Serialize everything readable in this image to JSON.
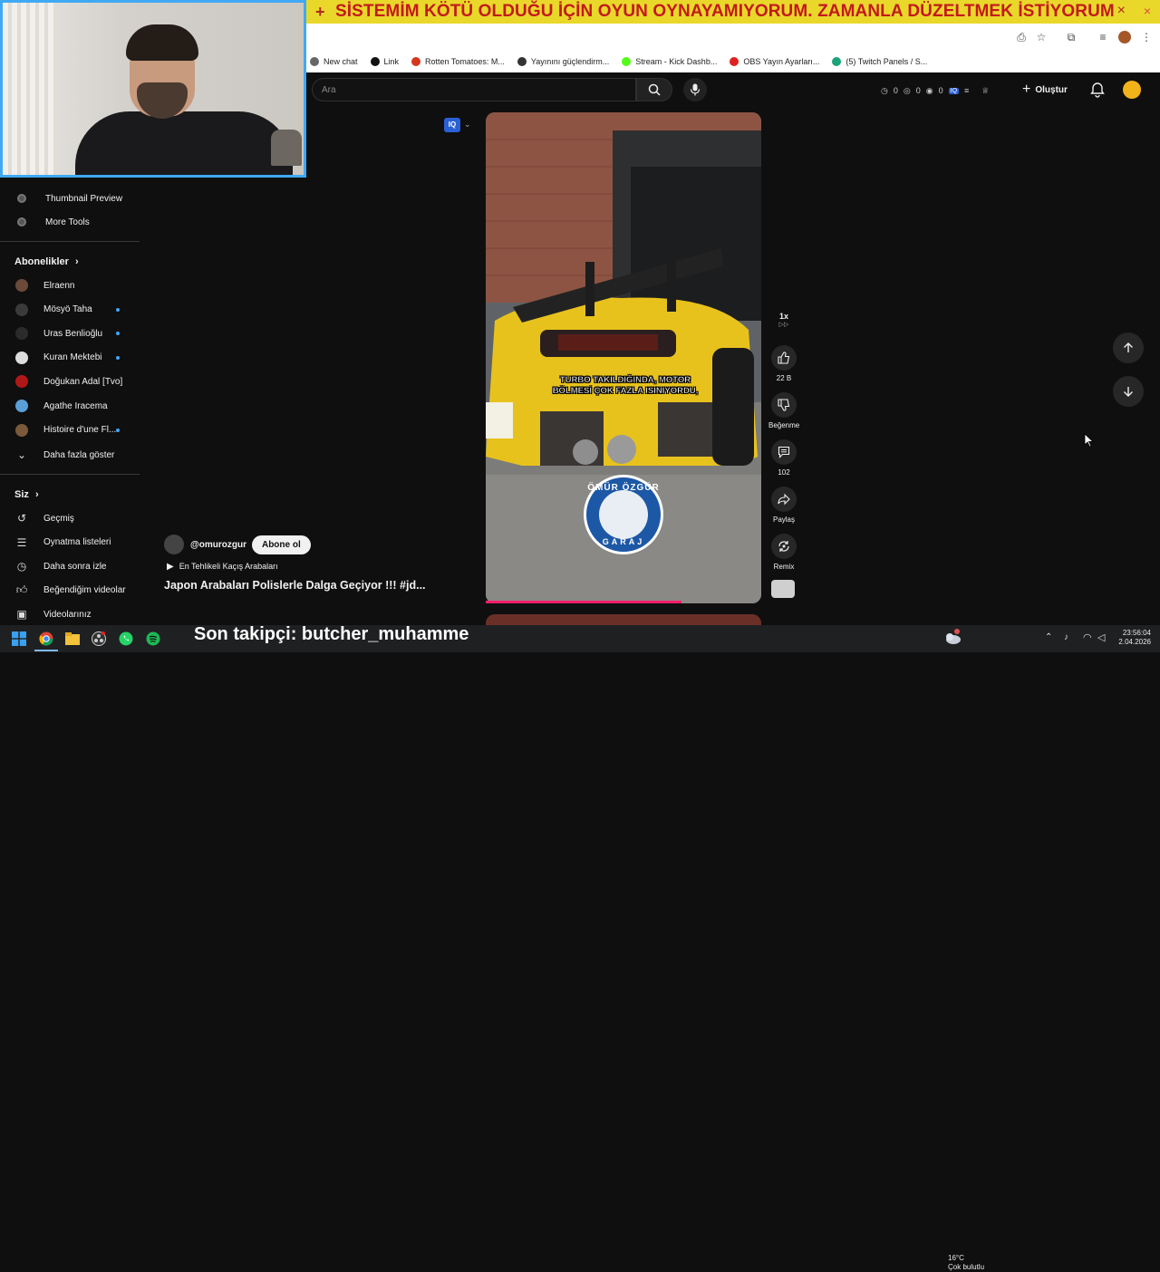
{
  "banner": {
    "text": "SİSTEMİM KÖTÜ OLDUĞU İÇİN OYUN OYNAYAMIYORUM. ZAMANLA DÜZELTMEK İSTİYORUM",
    "plus": "+",
    "close": "×"
  },
  "browser": {
    "close": "×"
  },
  "bookmarks": [
    {
      "label": "New chat",
      "color": "#666666"
    },
    {
      "label": "Link",
      "color": "#111111"
    },
    {
      "label": "Rotten Tomatoes: M...",
      "color": "#d6361b"
    },
    {
      "label": "Yayınını güçlendirm...",
      "color": "#333333"
    },
    {
      "label": "Stream - Kick Dashb...",
      "color": "#53fc18"
    },
    {
      "label": "OBS Yayın Ayarları...",
      "color": "#e02020"
    },
    {
      "label": "(5) Twitch Panels / S...",
      "color": "#1ba37a"
    }
  ],
  "sidebar": {
    "tools": [
      {
        "label": "Thumbnail Preview",
        "icon": "tool-icon"
      },
      {
        "label": "More Tools",
        "icon": "tool-icon"
      }
    ],
    "subscriptions_header": "Abonelikler",
    "subscriptions": [
      {
        "label": "Elraenn",
        "avatar_color": "#6b4a3a",
        "live": false
      },
      {
        "label": "Mösyö Taha",
        "avatar_color": "#3a3a3a",
        "live": true
      },
      {
        "label": "Uras Benlioğlu",
        "avatar_color": "#2b2b2b",
        "live": true
      },
      {
        "label": "Kuran Mektebi",
        "avatar_color": "#dddddd",
        "live": true
      },
      {
        "label": "Doğukan Adal [Tvo]",
        "avatar_color": "#b01818",
        "live": false
      },
      {
        "label": "Agathe Iracema",
        "avatar_color": "#5aa0d8",
        "live": false
      },
      {
        "label": "Histoire d'une Fl...",
        "avatar_color": "#7a5a3a",
        "live": true
      }
    ],
    "show_more": "Daha fazla göster",
    "you_header": "Siz",
    "you_items": [
      {
        "label": "Geçmiş",
        "icon": "history-icon"
      },
      {
        "label": "Oynatma listeleri",
        "icon": "playlist-icon"
      },
      {
        "label": "Daha sonra izle",
        "icon": "clock-icon"
      },
      {
        "label": "Beğendiğim videolar",
        "icon": "thumbs-up-icon"
      },
      {
        "label": "Videolarınız",
        "icon": "video-icon"
      }
    ]
  },
  "search": {
    "placeholder": "Ara"
  },
  "header": {
    "stats": [
      "0",
      "0",
      "0"
    ],
    "create_label": "Oluştur"
  },
  "short": {
    "caption": "TURBO TAKILDIĞINDA, MOTOR BÖLMESİ ÇOK FAZLA ISINIYORDU,",
    "logo_top": "ÖMÜR ÖZGÜR",
    "logo_bottom": "GARAJ",
    "progress": 0.71,
    "iq_badge": "IQ",
    "speed": "1x"
  },
  "actions": {
    "likes": "22 B",
    "dislike_label": "Beğenme",
    "comments": "102",
    "share_label": "Paylaş",
    "remix_label": "Remix"
  },
  "channel": {
    "handle": "@omurozgur",
    "subscribe_label": "Abone ol",
    "playlist": "En Tehlikeli Kaçış Arabaları",
    "title": "Japon Arabaları Polislerle Dalga Geçiyor !!! #jd..."
  },
  "overlay": {
    "follower": "Son takipçi: butcher_muhamme"
  },
  "taskbar": {
    "weather_temp": "16°C",
    "weather_desc": "Çok bulutlu",
    "time": "23:56:04",
    "date": "2.04.2026"
  }
}
